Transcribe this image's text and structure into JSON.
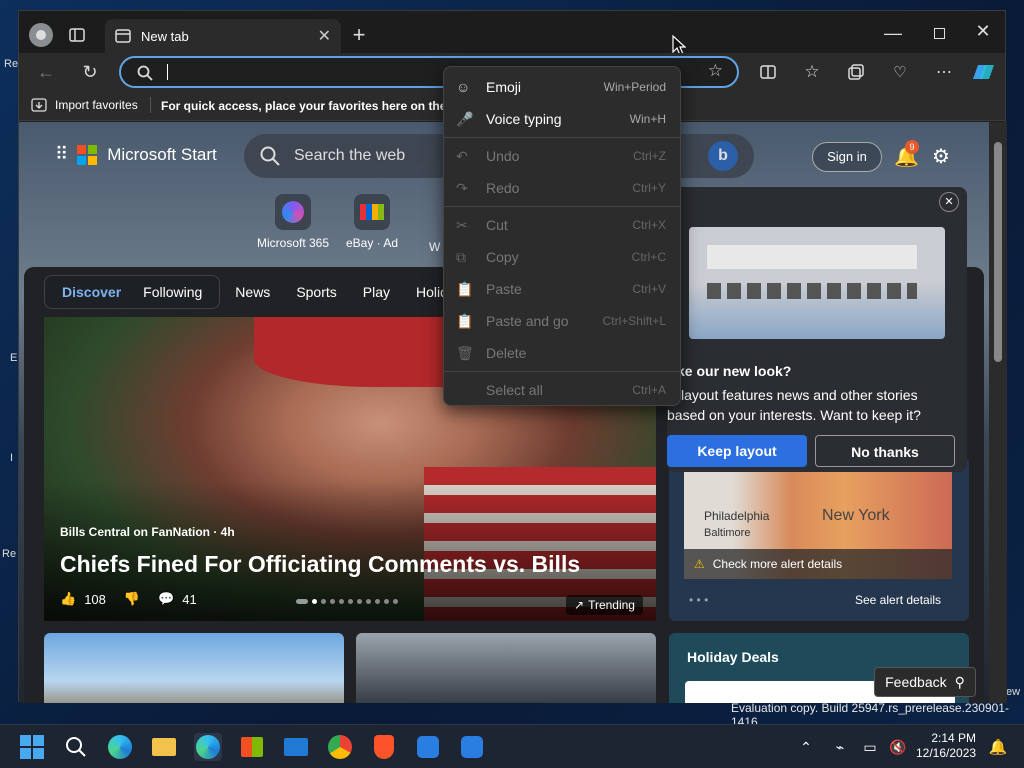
{
  "desktop": {
    "labels": [
      "Rec",
      "E",
      "I",
      "Re",
      "ew"
    ],
    "watermark": "Evaluation copy. Build 25947.rs_prerelease.230901-1416"
  },
  "browser": {
    "tab_title": "New tab",
    "add_tab": "+",
    "favbar_import": "Import favorites",
    "favbar_hint": "For quick access, place your favorites here on the fa"
  },
  "page": {
    "brand": "Microsoft Start",
    "search_placeholder": "Search the web",
    "sign_in": "Sign in",
    "notif_count": "9",
    "apps": [
      {
        "label": "Microsoft 365"
      },
      {
        "label": "eBay · Ad"
      },
      {
        "label": "W"
      }
    ],
    "tabs": [
      "Discover",
      "Following",
      "News",
      "Sports",
      "Play",
      "Holiday"
    ],
    "hero": {
      "source": "Bills Central on FanNation · 4h",
      "headline": "Chiefs Fined For Officiating Comments vs. Bills",
      "likes": "108",
      "comments": "41",
      "trending": "Trending"
    },
    "weather": {
      "city1": "Philadelphia",
      "city2": "New York",
      "city3": "Baltimore",
      "alert": "Check more alert details",
      "see_more": "See alert details"
    },
    "deals": {
      "title": "Holiday Deals"
    },
    "feedback": "Feedback"
  },
  "context_menu": {
    "items": [
      {
        "label": "Emoji",
        "shortcut": "Win+Period",
        "icon": "☺",
        "disabled": false
      },
      {
        "label": "Voice typing",
        "shortcut": "Win+H",
        "icon": "🎤",
        "disabled": false
      },
      {
        "label": "Undo",
        "shortcut": "Ctrl+Z",
        "icon": "↶",
        "disabled": true
      },
      {
        "label": "Redo",
        "shortcut": "Ctrl+Y",
        "icon": "↷",
        "disabled": true
      },
      {
        "label": "Cut",
        "shortcut": "Ctrl+X",
        "icon": "✂",
        "disabled": true
      },
      {
        "label": "Copy",
        "shortcut": "Ctrl+C",
        "icon": "⧉",
        "disabled": true
      },
      {
        "label": "Paste",
        "shortcut": "Ctrl+V",
        "icon": "📋",
        "disabled": true
      },
      {
        "label": "Paste and go",
        "shortcut": "Ctrl+Shift+L",
        "icon": "📋",
        "disabled": true
      },
      {
        "label": "Delete",
        "shortcut": "",
        "icon": "🗑",
        "disabled": true
      },
      {
        "label": "Select all",
        "shortcut": "Ctrl+A",
        "icon": "",
        "disabled": true
      }
    ]
  },
  "popup": {
    "title": "ke our new look?",
    "body": "is layout features news and other stories based on your interests. Want to keep it?",
    "keep": "Keep layout",
    "no": "No thanks"
  },
  "taskbar": {
    "time": "2:14 PM",
    "date": "12/16/2023"
  }
}
